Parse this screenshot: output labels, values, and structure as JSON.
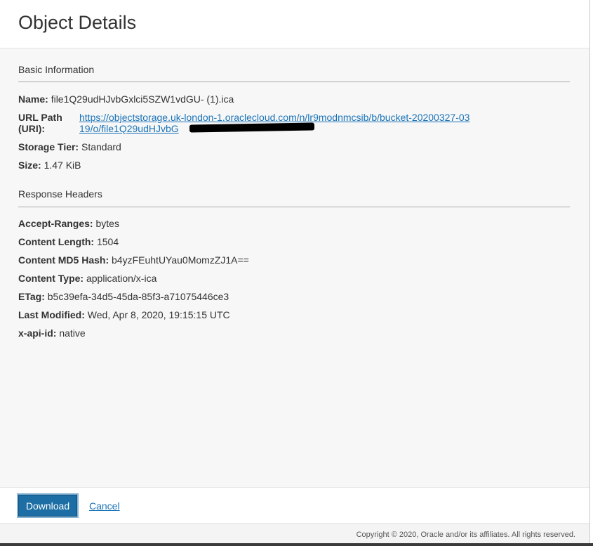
{
  "header": {
    "title": "Object Details"
  },
  "basic": {
    "section_title": "Basic Information",
    "name_label": "Name:",
    "name_value": "file1Q29udHJvbGxlci5SZW1vdGU- (1).ica",
    "url_label": "URL Path (URI):",
    "url_value": "https://objectstorage.uk-london-1.oraclecloud.com/n/lr9modnmcsib/b/bucket-20200327-0319/o/file1Q29udHJvbG",
    "tier_label": "Storage Tier:",
    "tier_value": "Standard",
    "size_label": "Size:",
    "size_value": "1.47 KiB"
  },
  "headers": {
    "section_title": "Response Headers",
    "items": [
      {
        "label": "Accept-Ranges:",
        "value": "bytes"
      },
      {
        "label": "Content Length:",
        "value": "1504"
      },
      {
        "label": "Content MD5 Hash:",
        "value": "b4yzFEuhtUYau0MomzZJ1A=="
      },
      {
        "label": "Content Type:",
        "value": "application/x-ica"
      },
      {
        "label": "ETag:",
        "value": "b5c39efa-34d5-45da-85f3-a71075446ce3"
      },
      {
        "label": "Last Modified:",
        "value": "Wed, Apr 8, 2020, 19:15:15 UTC"
      },
      {
        "label": "x-api-id:",
        "value": "native"
      }
    ]
  },
  "footer": {
    "download_label": "Download",
    "cancel_label": "Cancel",
    "copyright": "Copyright © 2020, Oracle and/or its affiliates. All rights reserved."
  },
  "colors": {
    "primary": "#1c6ea4",
    "link": "#1a73b8"
  }
}
